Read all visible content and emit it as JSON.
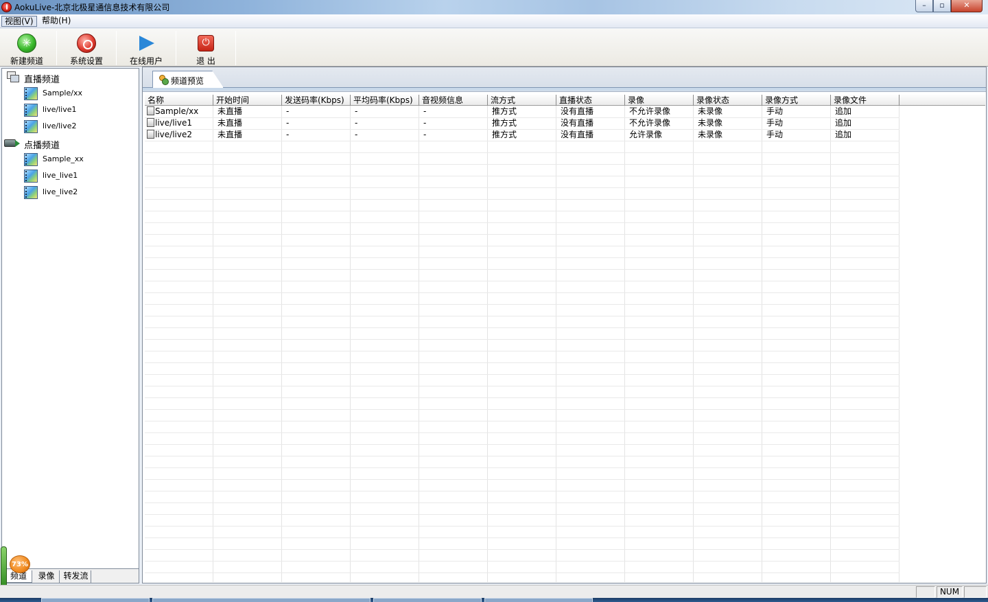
{
  "window": {
    "title": "AokuLive-北京北极星通信息技术有限公司",
    "minimize_glyph": "–",
    "maximize_glyph": "▫",
    "close_glyph": "✕"
  },
  "menu": {
    "items": [
      {
        "label": "视图(V)"
      },
      {
        "label": "帮助(H)"
      }
    ]
  },
  "toolbar": {
    "buttons": [
      {
        "label": "新建频道",
        "icon": "new-channel-icon"
      },
      {
        "label": "系统设置",
        "icon": "settings-icon"
      },
      {
        "label": "在线用户",
        "icon": "play-icon"
      },
      {
        "label": "退 出",
        "icon": "exit-icon"
      }
    ]
  },
  "tree": {
    "live_root": "直播频道",
    "live_children": [
      "Sample/xx",
      "live/live1",
      "live/live2"
    ],
    "vod_root": "点播频道",
    "vod_children": [
      "Sample_xx",
      "live_live1",
      "live_live2"
    ]
  },
  "left_tabs": [
    "频道",
    "录像",
    "转发流"
  ],
  "tray_badge": "73%",
  "doc_tab": {
    "label": "频道预览"
  },
  "grid": {
    "columns": [
      "名称",
      "开始时间",
      "发送码率(Kbps)",
      "平均码率(Kbps)",
      "音视频信息",
      "流方式",
      "直播状态",
      "录像",
      "录像状态",
      "录像方式",
      "录像文件"
    ],
    "rows": [
      [
        "Sample/xx",
        "未直播",
        "-",
        "-",
        "-",
        "推方式",
        "没有直播",
        "不允许录像",
        "未录像",
        "手动",
        "追加"
      ],
      [
        "live/live1",
        "未直播",
        "-",
        "-",
        "-",
        "推方式",
        "没有直播",
        "不允许录像",
        "未录像",
        "手动",
        "追加"
      ],
      [
        "live/live2",
        "未直播",
        "-",
        "-",
        "-",
        "推方式",
        "没有直播",
        "允许录像",
        "未录像",
        "手动",
        "追加"
      ]
    ]
  },
  "statusbar": {
    "num": "NUM"
  }
}
